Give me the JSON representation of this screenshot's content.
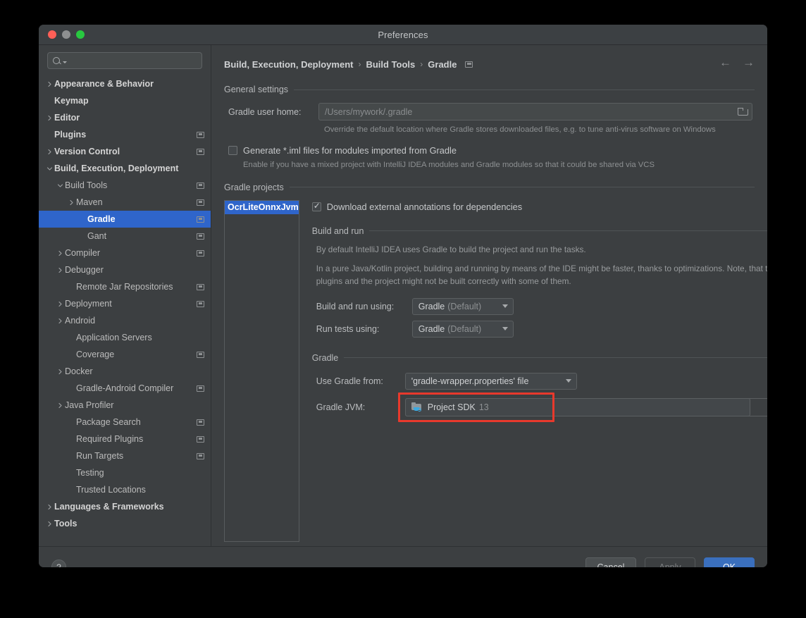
{
  "window": {
    "title": "Preferences",
    "traffic_lights": [
      "close-button",
      "minimize-button",
      "zoom-button"
    ]
  },
  "sidebar": {
    "search": {
      "placeholder": "",
      "value": "",
      "icon": "search-icon"
    },
    "items": [
      {
        "label": "Appearance & Behavior",
        "indent": 0,
        "arrow": "right",
        "bold": true,
        "cfg": false,
        "selected": false
      },
      {
        "label": "Keymap",
        "indent": 0,
        "arrow": "none",
        "bold": true,
        "cfg": false,
        "selected": false
      },
      {
        "label": "Editor",
        "indent": 0,
        "arrow": "right",
        "bold": true,
        "cfg": false,
        "selected": false
      },
      {
        "label": "Plugins",
        "indent": 0,
        "arrow": "none",
        "bold": true,
        "cfg": true,
        "selected": false
      },
      {
        "label": "Version Control",
        "indent": 0,
        "arrow": "right",
        "bold": true,
        "cfg": true,
        "selected": false
      },
      {
        "label": "Build, Execution, Deployment",
        "indent": 0,
        "arrow": "down",
        "bold": true,
        "cfg": false,
        "selected": false
      },
      {
        "label": "Build Tools",
        "indent": 1,
        "arrow": "down",
        "bold": false,
        "cfg": true,
        "selected": false
      },
      {
        "label": "Maven",
        "indent": 2,
        "arrow": "right",
        "bold": false,
        "cfg": true,
        "selected": false
      },
      {
        "label": "Gradle",
        "indent": 3,
        "arrow": "none",
        "bold": true,
        "cfg": true,
        "selected": true
      },
      {
        "label": "Gant",
        "indent": 3,
        "arrow": "none",
        "bold": false,
        "cfg": true,
        "selected": false
      },
      {
        "label": "Compiler",
        "indent": 1,
        "arrow": "right",
        "bold": false,
        "cfg": true,
        "selected": false
      },
      {
        "label": "Debugger",
        "indent": 1,
        "arrow": "right",
        "bold": false,
        "cfg": false,
        "selected": false
      },
      {
        "label": "Remote Jar Repositories",
        "indent": 2,
        "arrow": "none",
        "bold": false,
        "cfg": true,
        "selected": false
      },
      {
        "label": "Deployment",
        "indent": 1,
        "arrow": "right",
        "bold": false,
        "cfg": true,
        "selected": false
      },
      {
        "label": "Android",
        "indent": 1,
        "arrow": "right",
        "bold": false,
        "cfg": false,
        "selected": false
      },
      {
        "label": "Application Servers",
        "indent": 2,
        "arrow": "none",
        "bold": false,
        "cfg": false,
        "selected": false
      },
      {
        "label": "Coverage",
        "indent": 2,
        "arrow": "none",
        "bold": false,
        "cfg": true,
        "selected": false
      },
      {
        "label": "Docker",
        "indent": 1,
        "arrow": "right",
        "bold": false,
        "cfg": false,
        "selected": false
      },
      {
        "label": "Gradle-Android Compiler",
        "indent": 2,
        "arrow": "none",
        "bold": false,
        "cfg": true,
        "selected": false
      },
      {
        "label": "Java Profiler",
        "indent": 1,
        "arrow": "right",
        "bold": false,
        "cfg": false,
        "selected": false
      },
      {
        "label": "Package Search",
        "indent": 2,
        "arrow": "none",
        "bold": false,
        "cfg": true,
        "selected": false
      },
      {
        "label": "Required Plugins",
        "indent": 2,
        "arrow": "none",
        "bold": false,
        "cfg": true,
        "selected": false
      },
      {
        "label": "Run Targets",
        "indent": 2,
        "arrow": "none",
        "bold": false,
        "cfg": true,
        "selected": false
      },
      {
        "label": "Testing",
        "indent": 2,
        "arrow": "none",
        "bold": false,
        "cfg": false,
        "selected": false
      },
      {
        "label": "Trusted Locations",
        "indent": 2,
        "arrow": "none",
        "bold": false,
        "cfg": false,
        "selected": false
      },
      {
        "label": "Languages & Frameworks",
        "indent": 0,
        "arrow": "right",
        "bold": true,
        "cfg": false,
        "selected": false
      },
      {
        "label": "Tools",
        "indent": 0,
        "arrow": "right",
        "bold": true,
        "cfg": false,
        "selected": false
      }
    ]
  },
  "main": {
    "breadcrumb": {
      "items": [
        "Build, Execution, Deployment",
        "Build Tools",
        "Gradle"
      ],
      "separator": "›",
      "trailing_icon": "settings-panel-icon"
    },
    "nav": {
      "back": "←",
      "forward": "→"
    },
    "general_settings": {
      "title": "General settings",
      "gradle_user_home": {
        "label": "Gradle user home:",
        "placeholder": "/Users/mywork/.gradle",
        "value": "",
        "browse_icon": "folder-icon",
        "hint": "Override the default location where Gradle stores downloaded files, e.g. to tune anti-virus software on Windows"
      },
      "generate_iml": {
        "label": "Generate *.iml files for modules imported from Gradle",
        "checked": false,
        "hint": "Enable if you have a mixed project with IntelliJ IDEA modules and Gradle modules so that it could be shared via VCS"
      }
    },
    "gradle_projects": {
      "title": "Gradle projects",
      "projects": [
        "OcrLiteOnnxJvm"
      ],
      "selected_project": "OcrLiteOnnxJvm",
      "download_annotations": {
        "label": "Download external annotations for dependencies",
        "checked": true
      },
      "build_and_run": {
        "title": "Build and run",
        "paragraph1": "By default IntelliJ IDEA uses Gradle to build the project and run the tasks.",
        "paragraph2": "In a pure Java/Kotlin project, building and running by means of the IDE might be faster, thanks to optimizations. Note, that the IDE doesn't support all Gradle plugins and the project might not be built correctly with some of them.",
        "build_and_run_using": {
          "label": "Build and run using:",
          "value": "Gradle",
          "value_suffix": "(Default)"
        },
        "run_tests_using": {
          "label": "Run tests using:",
          "value": "Gradle",
          "value_suffix": "(Default)"
        }
      },
      "gradle": {
        "title": "Gradle",
        "use_gradle_from": {
          "label": "Use Gradle from:",
          "value": "'gradle-wrapper.properties' file"
        },
        "gradle_jvm": {
          "label": "Gradle JVM:",
          "value": "Project SDK",
          "value_suffix": "13",
          "icon": "jdk-folder-icon",
          "highlight_color": "#e8392c"
        }
      }
    }
  },
  "footer": {
    "help": "?",
    "cancel": "Cancel",
    "apply": "Apply",
    "ok": "OK"
  }
}
